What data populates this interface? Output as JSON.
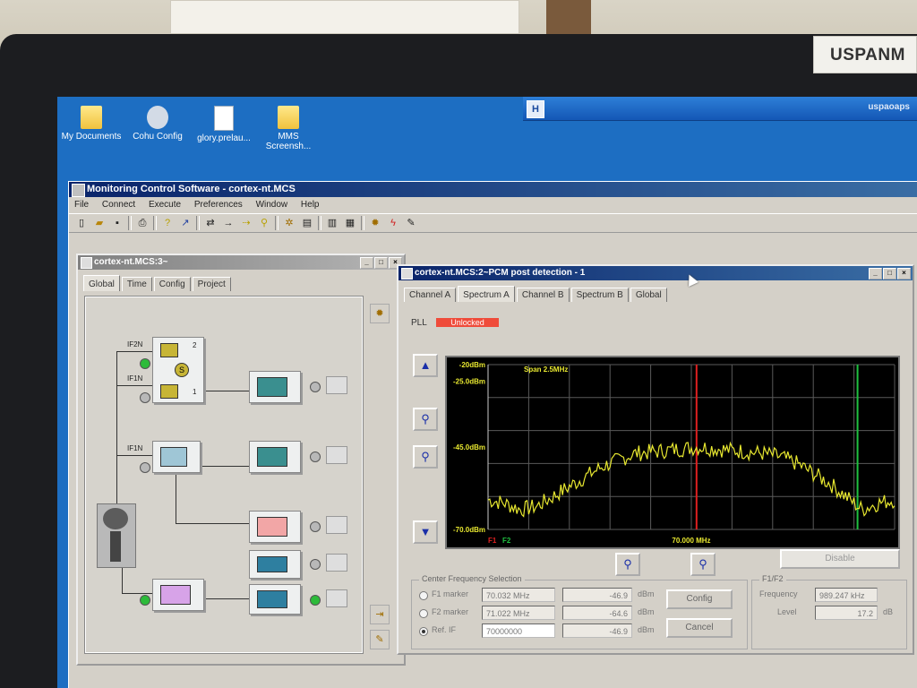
{
  "photo": {
    "sticker_text": "USPANM"
  },
  "desktop": {
    "icons": [
      {
        "label": "My Documents",
        "icon": "documents-folder-icon"
      },
      {
        "label": "Cohu Config",
        "icon": "tool-icon"
      },
      {
        "label": "glory.prelau...",
        "icon": "file-icon"
      },
      {
        "label": "MMS Screensh...",
        "icon": "folder-icon"
      }
    ],
    "taskbar_user": "uspaoaps"
  },
  "app": {
    "title": "Monitoring Control Software - cortex-nt.MCS",
    "menu": [
      "File",
      "Connect",
      "Execute",
      "Preferences",
      "Window",
      "Help"
    ]
  },
  "config_window": {
    "title": "cortex-nt.MCS:3~",
    "tabs": [
      "Global",
      "Time",
      "Config",
      "Project"
    ],
    "selected_tab": "Global",
    "labels": {
      "if2n": "IF2N",
      "if1n_top": "IF1N",
      "if1n_mid": "IF1N",
      "in2": "2",
      "in1": "1"
    }
  },
  "spectrum_window": {
    "title": "cortex-nt.MCS:2~PCM post detection - 1",
    "tabs": [
      "Channel A",
      "Spectrum A",
      "Channel B",
      "Spectrum B",
      "Global"
    ],
    "selected_tab": "Spectrum A",
    "pll_label": "PLL",
    "pll_status": "Unlocked",
    "pll_status_color": "#ef4b3a",
    "disable_button": "Disable",
    "center_group": {
      "title": "Center Frequency Selection",
      "rows": [
        {
          "label": "F1 marker",
          "freq": "70.032 MHz",
          "level": "-46.9",
          "unit": "dBm",
          "selected": false
        },
        {
          "label": "F2 marker",
          "freq": "71.022 MHz",
          "level": "-64.6",
          "unit": "dBm",
          "selected": false
        },
        {
          "label": "Ref. IF",
          "freq": "70000000",
          "level": "-46.9",
          "unit": "dBm",
          "selected": true
        }
      ],
      "config_button": "Config",
      "cancel_button": "Cancel"
    },
    "f1f2_group": {
      "title": "F1/F2",
      "frequency_label": "Frequency",
      "frequency_value": "989.247 kHz",
      "level_label": "Level",
      "level_value": "17.2",
      "level_unit": "dB"
    }
  },
  "chart_data": {
    "type": "line",
    "title": "Span 2.5MHz",
    "xlabel": "70.000 MHz",
    "ylabel": "",
    "y_tick_labels": [
      "-20dBm",
      "-25.0dBm",
      "-45.0dBm",
      "-70.0dBm"
    ],
    "y_ticks": [
      -20,
      -25,
      -45,
      -70
    ],
    "ylim": [
      -70,
      -20
    ],
    "xlim": [
      68.75,
      71.25
    ],
    "grid": true,
    "markers": [
      {
        "name": "F1",
        "x": 70.032,
        "color": "#e02020"
      },
      {
        "name": "F2",
        "x": 71.022,
        "color": "#20c040"
      }
    ],
    "series": [
      {
        "color": "#e8e830",
        "x": [
          68.75,
          68.85,
          68.95,
          69.05,
          69.15,
          69.25,
          69.35,
          69.45,
          69.55,
          69.65,
          69.75,
          69.85,
          69.95,
          70.05,
          70.15,
          70.25,
          70.35,
          70.45,
          70.55,
          70.65,
          70.75,
          70.85,
          70.95,
          71.05,
          71.15,
          71.25
        ],
        "y": [
          -61,
          -62,
          -64,
          -63,
          -60,
          -57,
          -54,
          -51,
          -49,
          -47,
          -46.5,
          -46,
          -45.5,
          -45,
          -45.5,
          -46,
          -46.5,
          -47,
          -48,
          -50,
          -53,
          -56,
          -60,
          -64,
          -62,
          -61
        ]
      }
    ]
  }
}
